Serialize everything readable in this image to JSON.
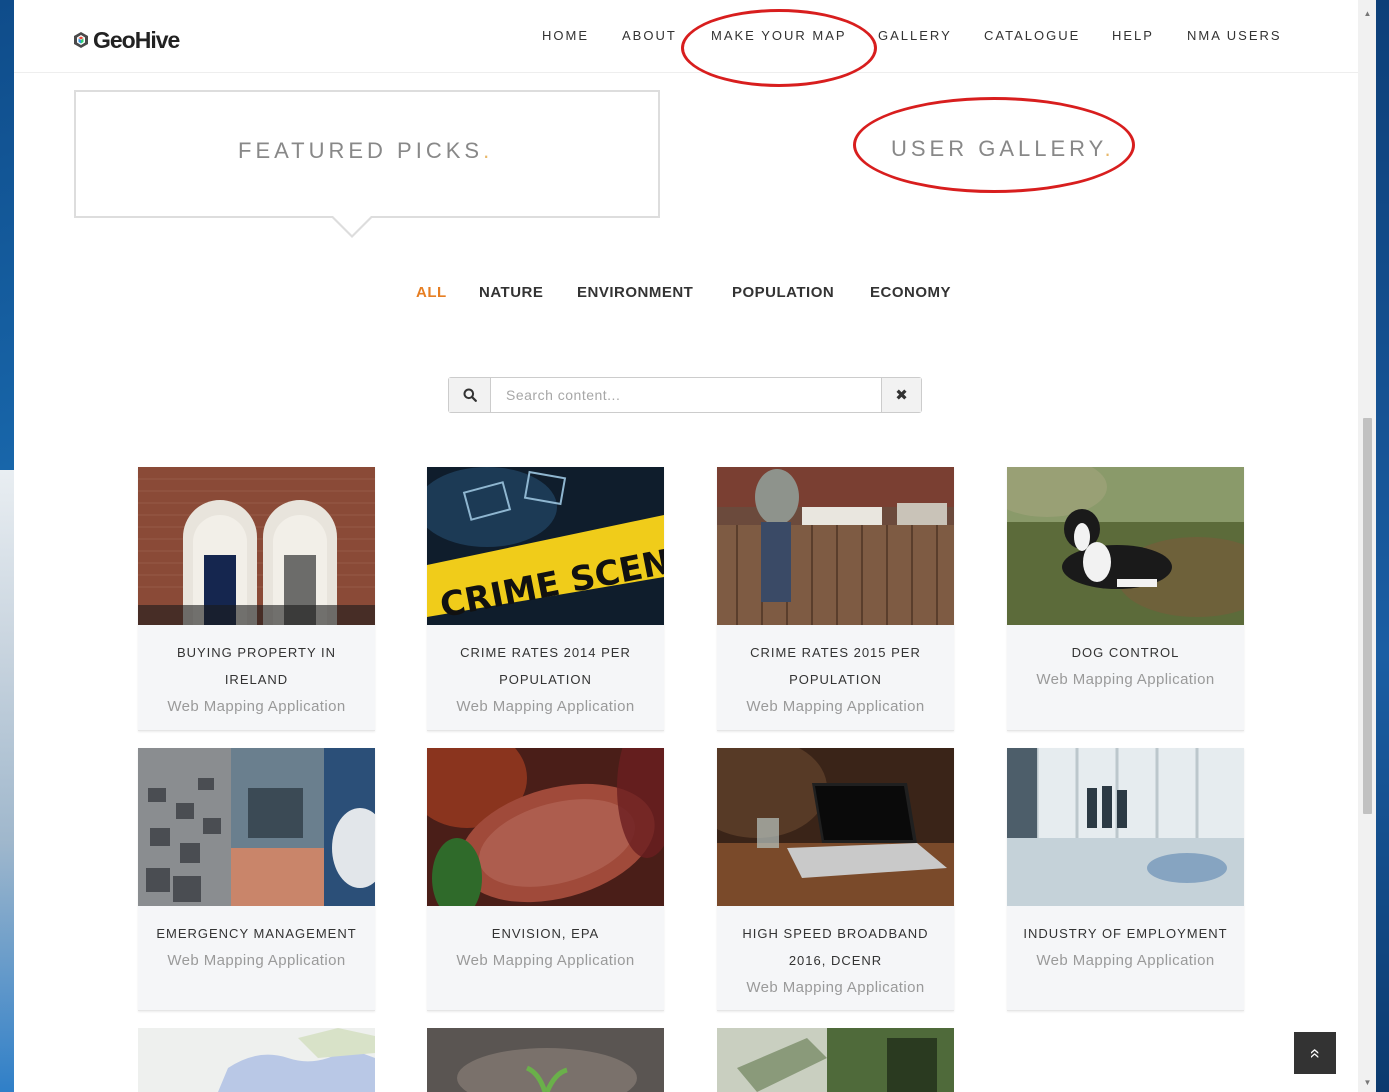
{
  "logo": {
    "text": "GeoHive"
  },
  "nav": [
    {
      "label": "HOME"
    },
    {
      "label": "ABOUT"
    },
    {
      "label": "MAKE YOUR MAP"
    },
    {
      "label": "GALLERY"
    },
    {
      "label": "CATALOGUE"
    },
    {
      "label": "HELP"
    },
    {
      "label": "NMA USERS"
    }
  ],
  "tabs": {
    "featured": {
      "label": "FEATURED PICKS",
      "dot": "."
    },
    "user_gallery": {
      "label": "USER GALLERY",
      "dot": "."
    }
  },
  "filters": [
    {
      "label": "ALL",
      "active": true
    },
    {
      "label": "NATURE",
      "active": false
    },
    {
      "label": "ENVIRONMENT",
      "active": false
    },
    {
      "label": "POPULATION",
      "active": false
    },
    {
      "label": "ECONOMY",
      "active": false
    }
  ],
  "search": {
    "placeholder": "Search content...",
    "icon": "search-icon",
    "clear_glyph": "✖"
  },
  "cards": [
    {
      "title": "BUYING PROPERTY IN IRELAND",
      "subtitle": "Web Mapping Application"
    },
    {
      "title": "CRIME RATES 2014 PER POPULATION",
      "subtitle": "Web Mapping Application"
    },
    {
      "title": "CRIME RATES 2015 PER POPULATION",
      "subtitle": "Web Mapping Application"
    },
    {
      "title": "DOG CONTROL",
      "subtitle": "Web Mapping Application"
    },
    {
      "title": "EMERGENCY MANAGEMENT",
      "subtitle": "Web Mapping Application"
    },
    {
      "title": "ENVISION, EPA",
      "subtitle": "Web Mapping Application"
    },
    {
      "title": "HIGH SPEED BROADBAND 2016, DCENR",
      "subtitle": "Web Mapping Application"
    },
    {
      "title": "INDUSTRY OF EMPLOYMENT",
      "subtitle": "Web Mapping Application"
    }
  ],
  "crime_tape_text": "CRIME SCENE DO NOT CROSS",
  "scroll_top_glyph": "«",
  "colors": {
    "accent_active_filter": "#e67e22",
    "annotation_red": "#d81e1e",
    "card_bg": "#f5f6f8",
    "subtitle_gray": "#9a9a9a"
  }
}
